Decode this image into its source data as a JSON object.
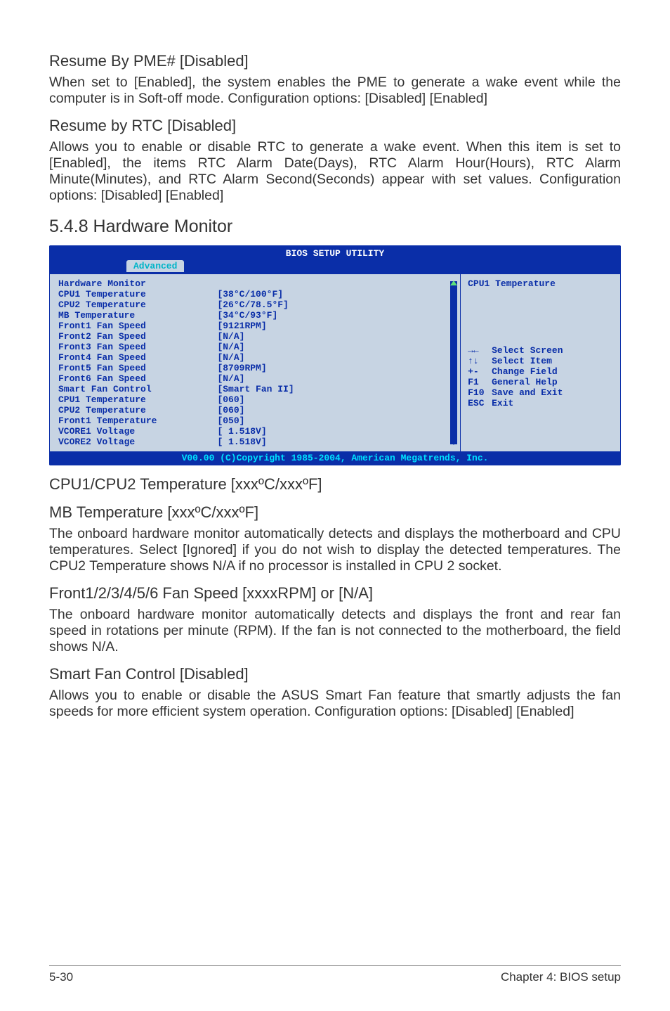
{
  "sections": {
    "resume_pme": {
      "title": "Resume By PME# [Disabled]",
      "body": "When set to [Enabled], the system enables the PME to generate a wake event while the computer is in Soft-off mode. Configuration options: [Disabled] [Enabled]"
    },
    "resume_rtc": {
      "title": "Resume by RTC [Disabled]",
      "body": "Allows you to enable or disable RTC to generate a wake event. When this item is set to [Enabled], the items RTC Alarm Date(Days), RTC Alarm Hour(Hours), RTC Alarm Minute(Minutes), and RTC Alarm Second(Seconds) appear with set values. Configuration options: [Disabled] [Enabled]"
    },
    "hwmon_heading": "5.4.8 Hardware Monitor",
    "cpu_temp": {
      "title": "CPU1/CPU2 Temperature [xxxºC/xxxºF]"
    },
    "mb_temp": {
      "title": "MB Temperature [xxxºC/xxxºF]",
      "body": "The onboard hardware monitor automatically detects and displays the motherboard and CPU temperatures. Select [Ignored] if you do not wish to display the detected temperatures. The CPU2 Temperature shows N/A if no processor is installed in CPU 2 socket."
    },
    "fan_speed": {
      "title": "Front1/2/3/4/5/6 Fan Speed [xxxxRPM] or [N/A]",
      "body": "The onboard hardware monitor automatically detects and displays the front and rear fan speed in rotations per minute (RPM). If the fan is not connected to the motherboard, the field shows N/A."
    },
    "smart_fan": {
      "title": "Smart Fan Control [Disabled]",
      "body": "Allows you to enable or disable the ASUS Smart Fan feature that smartly adjusts the fan speeds for more efficient system operation. Configuration options: [Disabled] [Enabled]"
    }
  },
  "bios": {
    "title": "BIOS SETUP UTILITY",
    "tab": "Advanced",
    "main_rows": [
      {
        "label": "Hardware Monitor",
        "value": ""
      },
      {
        "label": "CPU1 Temperature",
        "value": "[38°C/100°F]"
      },
      {
        "label": "CPU2 Temperature",
        "value": "[26°C/78.5°F]"
      },
      {
        "label": "MB Temperature",
        "value": "[34°C/93°F]"
      },
      {
        "label": "",
        "value": ""
      },
      {
        "label": "Front1 Fan Speed",
        "value": "[9121RPM]"
      },
      {
        "label": "Front2 Fan Speed",
        "value": "[N/A]"
      },
      {
        "label": "Front3 Fan Speed",
        "value": "[N/A]"
      },
      {
        "label": "Front4 Fan Speed",
        "value": "[N/A]"
      },
      {
        "label": "Front5 Fan Speed",
        "value": "[8709RPM]"
      },
      {
        "label": "Front6 Fan Speed",
        "value": "[N/A]"
      },
      {
        "label": "",
        "value": ""
      },
      {
        "label": "Smart Fan Control",
        "value": "[Smart Fan II]"
      },
      {
        "label": "",
        "value": ""
      },
      {
        "label": "CPU1 Temperature",
        "value": "[060]"
      },
      {
        "label": "CPU2 Temperature",
        "value": "[060]"
      },
      {
        "label": "Front1 Temperature",
        "value": "[050]"
      },
      {
        "label": "VCORE1 Voltage",
        "value": "[ 1.518V]"
      },
      {
        "label": "VCORE2 Voltage",
        "value": "[ 1.518V]"
      }
    ],
    "help_title": "CPU1 Temperature",
    "keys": [
      {
        "k": "→←",
        "d": "Select Screen"
      },
      {
        "k": "↑↓",
        "d": "Select Item"
      },
      {
        "k": "+-",
        "d": "Change Field"
      },
      {
        "k": "F1",
        "d": "General Help"
      },
      {
        "k": "F10",
        "d": "Save and Exit"
      },
      {
        "k": "ESC",
        "d": "Exit"
      }
    ],
    "footer": "V00.00 (C)Copyright 1985-2004, American Megatrends, Inc."
  },
  "footer": {
    "left": "5-30",
    "right": "Chapter 4: BIOS setup"
  }
}
